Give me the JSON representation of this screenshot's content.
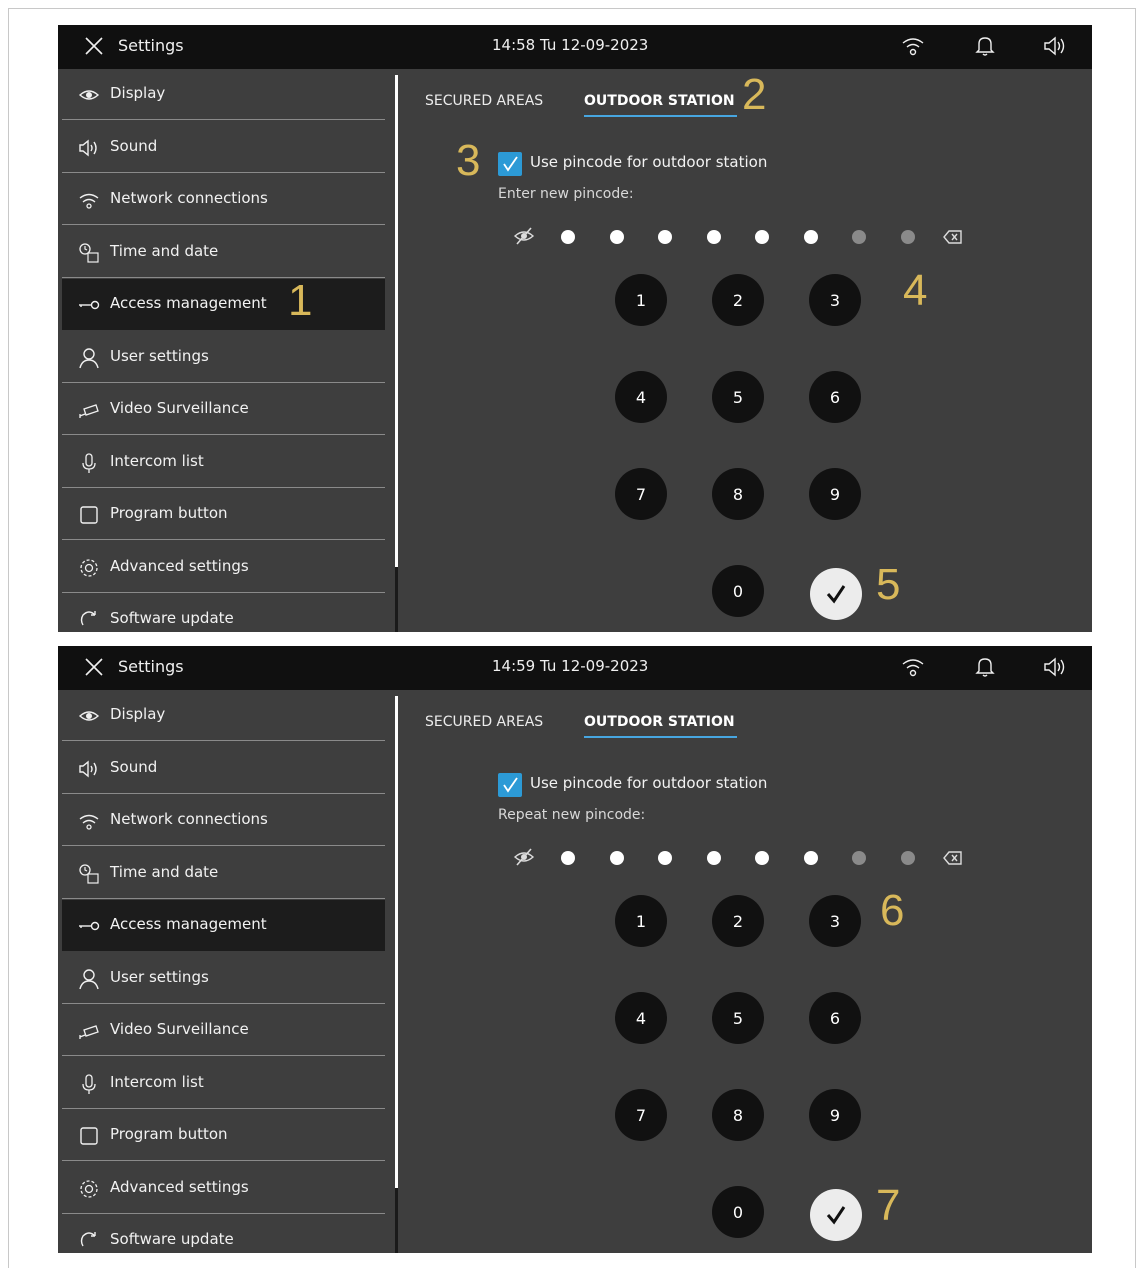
{
  "screens": [
    {
      "topbar": {
        "title": "Settings",
        "clock": "14:58  Tu 12-09-2023"
      },
      "menu": [
        {
          "label": "Display",
          "icon": "eye-icon"
        },
        {
          "label": "Sound",
          "icon": "speaker-icon"
        },
        {
          "label": "Network connections",
          "icon": "wifi-icon"
        },
        {
          "label": "Time and date",
          "icon": "clock-calendar-icon"
        },
        {
          "label": "Access  management",
          "icon": "key-icon",
          "active": true
        },
        {
          "label": "User settings",
          "icon": "user-icon"
        },
        {
          "label": "Video Surveillance",
          "icon": "camera-icon"
        },
        {
          "label": "Intercom list",
          "icon": "microphone-icon"
        },
        {
          "label": "Program button",
          "icon": "square-button-icon"
        },
        {
          "label": "Advanced settings",
          "icon": "gear-icon"
        },
        {
          "label": "Software update",
          "icon": "refresh-icon"
        }
      ],
      "tabs": {
        "secured_areas": "SECURED AREAS",
        "outdoor_station": "OUTDOOR STATION"
      },
      "checkbox_label": "Use pincode for outdoor station",
      "checkbox_checked": true,
      "pin_prompt": "Enter new pincode:",
      "pin_filled": 6,
      "pin_total": 8,
      "keypad": [
        "1",
        "2",
        "3",
        "4",
        "5",
        "6",
        "7",
        "8",
        "9",
        "0"
      ],
      "callouts": {
        "menu": "1",
        "tab": "2",
        "checkbox": "3",
        "keypad": "4",
        "confirm": "5"
      }
    },
    {
      "topbar": {
        "title": "Settings",
        "clock": "14:59  Tu 12-09-2023"
      },
      "menu": [
        {
          "label": "Display",
          "icon": "eye-icon"
        },
        {
          "label": "Sound",
          "icon": "speaker-icon"
        },
        {
          "label": "Network connections",
          "icon": "wifi-icon"
        },
        {
          "label": "Time and date",
          "icon": "clock-calendar-icon"
        },
        {
          "label": "Access  management",
          "icon": "key-icon",
          "active": true
        },
        {
          "label": "User settings",
          "icon": "user-icon"
        },
        {
          "label": "Video Surveillance",
          "icon": "camera-icon"
        },
        {
          "label": "Intercom list",
          "icon": "microphone-icon"
        },
        {
          "label": "Program button",
          "icon": "square-button-icon"
        },
        {
          "label": "Advanced settings",
          "icon": "gear-icon"
        },
        {
          "label": "Software update",
          "icon": "refresh-icon"
        }
      ],
      "tabs": {
        "secured_areas": "SECURED AREAS",
        "outdoor_station": "OUTDOOR STATION"
      },
      "checkbox_label": "Use pincode for outdoor station",
      "checkbox_checked": true,
      "pin_prompt": "Repeat new pincode:",
      "pin_filled": 6,
      "pin_total": 8,
      "keypad": [
        "1",
        "2",
        "3",
        "4",
        "5",
        "6",
        "7",
        "8",
        "9",
        "0"
      ],
      "callouts": {
        "keypad": "6",
        "confirm": "7"
      }
    }
  ],
  "colors": {
    "screen_bg": "#3e3e3e",
    "topbar_bg": "#101010",
    "active_item_bg": "#1c1c1c",
    "accent_blue": "#2c9ad6",
    "callout_gold": "#d8b85a"
  }
}
